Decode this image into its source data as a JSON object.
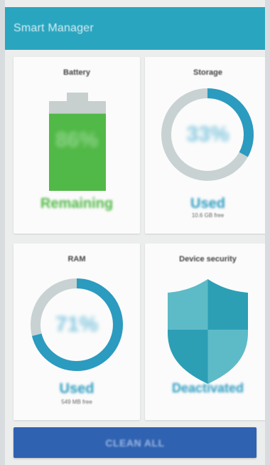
{
  "app_title": "Smart Manager",
  "battery": {
    "heading": "Battery",
    "percent_text": "86%",
    "level": 0.86,
    "status": "Remaining"
  },
  "storage": {
    "heading": "Storage",
    "percent_text": "33%",
    "used_fraction": 0.33,
    "status": "Used",
    "free_text": "10.6 GB free"
  },
  "ram": {
    "heading": "RAM",
    "percent_text": "71%",
    "used_fraction": 0.71,
    "status": "Used",
    "free_text": "549 MB free"
  },
  "security": {
    "heading": "Device security",
    "status": "Deactivated"
  },
  "clean_all_label": "CLEAN ALL",
  "colors": {
    "app_bar": "#2aa5bf",
    "battery_green": "#51b947",
    "accent_blue": "#2b9bc0",
    "ring_track": "#c8d2d3",
    "button_blue": "#2f62b0"
  }
}
